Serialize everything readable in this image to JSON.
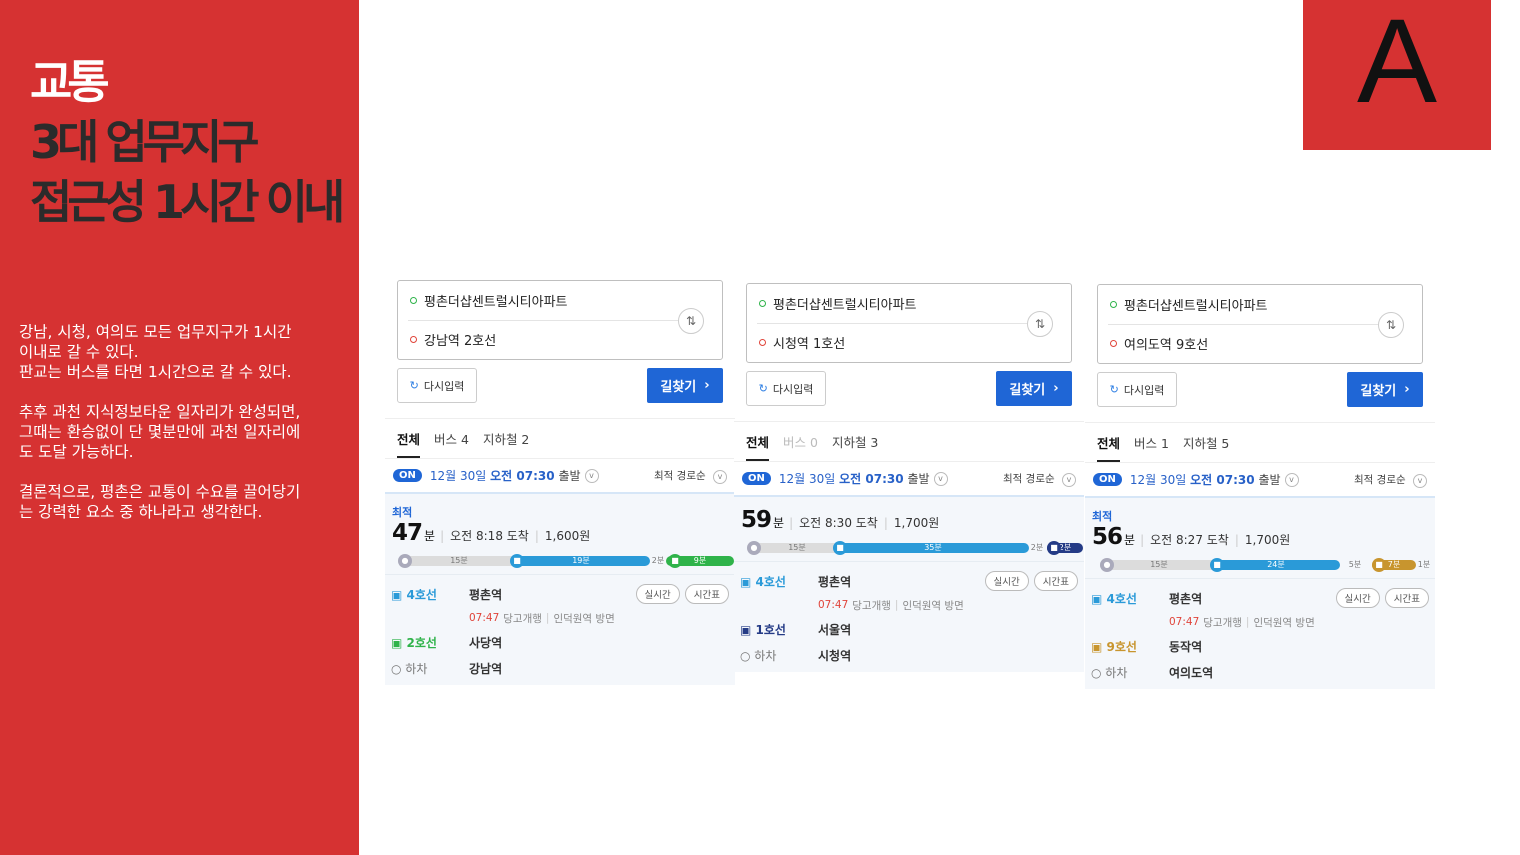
{
  "left_panel": {
    "title_line1": "교통",
    "title_line2": "3대 업무지구",
    "title_line3": "접근성 1시간 이내",
    "paragraphs": [
      "강남, 시청, 여의도 모든 업무지구가 1시간\n이내로 갈 수 있다.\n판교는 버스를 타면 1시간으로 갈 수 있다.",
      "추후 과천 지식정보타운 일자리가 완성되면,\n그때는 환승없이 단 몇분만에 과천 일자리에\n도 도달 가능하다.",
      "결론적으로, 평촌은 교통이 수요를 끌어당기\n는 강력한 요소 중 하나라고 생각한다."
    ]
  },
  "corner_label": "A",
  "colors": {
    "accent_red": "#d63232",
    "primary_blue": "#1f66d6",
    "line4": "#2a9ad8",
    "line2": "#2fb34a",
    "line1": "#243b86",
    "line9": "#c8952e"
  },
  "common": {
    "reset_label": "다시입력",
    "find_label": "길찾기",
    "tab_all": "전체",
    "on_badge": "ON",
    "date": "12월 30일",
    "time_bold": "오전 07:30",
    "depart_suffix": "출발",
    "sort_label": "최적 경로순",
    "best_label": "최적",
    "minute_unit": "분",
    "realtime_label": "실시간",
    "timetable_label": "시간표",
    "getoff_label": "하차",
    "departure_time": "07:47",
    "train_info": "당고개행",
    "direction": "인덕원역 방면"
  },
  "cards": [
    {
      "from": "평촌더샵센트럴시티아파트",
      "to": "강남역 2호선",
      "tab_bus": "버스 4",
      "tab_subway": "지하철 2",
      "show_best": true,
      "total_min": "47",
      "arrive": "오전 8:18 도착",
      "fare": "1,600원",
      "bar": {
        "walk1": "15분",
        "ride1": "19분",
        "transfer": "2분",
        "ride2": "9분"
      },
      "steps": [
        {
          "line": "4호선",
          "station": "평촌역",
          "color": "#2a9ad8"
        },
        {
          "line": "2호선",
          "station": "사당역",
          "color": "#2fb34a"
        },
        {
          "line": "",
          "station": "강남역"
        }
      ]
    },
    {
      "from": "평촌더샵센트럴시티아파트",
      "to": "시청역 1호선",
      "tab_bus": "버스 0",
      "tab_subway": "지하철 3",
      "show_best": false,
      "total_min": "59",
      "arrive": "오전 8:30 도착",
      "fare": "1,700원",
      "bar": {
        "walk1": "15분",
        "ride1": "35분",
        "transfer": "2분",
        "ride2": "2분"
      },
      "steps": [
        {
          "line": "4호선",
          "station": "평촌역",
          "color": "#2a9ad8"
        },
        {
          "line": "1호선",
          "station": "서울역",
          "color": "#243b86"
        },
        {
          "line": "",
          "station": "시청역"
        }
      ]
    },
    {
      "from": "평촌더샵센트럴시티아파트",
      "to": "여의도역 9호선",
      "tab_bus": "버스 1",
      "tab_subway": "지하철 5",
      "show_best": true,
      "total_min": "56",
      "arrive": "오전 8:27 도착",
      "fare": "1,700원",
      "bar": {
        "walk1": "15분",
        "ride1": "24분",
        "transfer": "5분",
        "ride2": "7분",
        "walk2": "1분"
      },
      "steps": [
        {
          "line": "4호선",
          "station": "평촌역",
          "color": "#2a9ad8"
        },
        {
          "line": "9호선",
          "station": "동작역",
          "color": "#c8952e"
        },
        {
          "line": "",
          "station": "여의도역"
        }
      ]
    }
  ]
}
